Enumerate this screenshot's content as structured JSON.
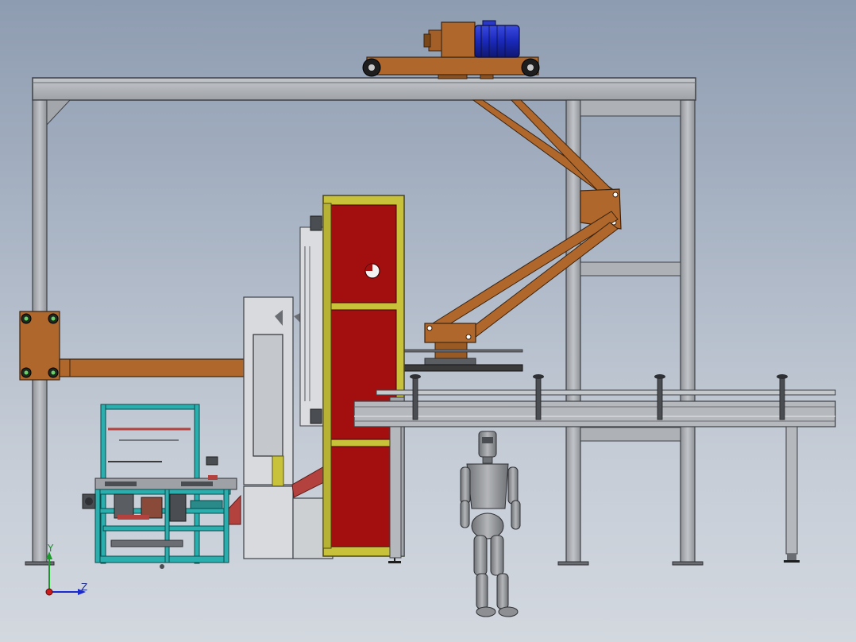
{
  "triad": {
    "y_label": "Y",
    "z_label": "Z"
  },
  "colors": {
    "frame": "#a3a6ab",
    "frame_dark": "#4a4d52",
    "brown": "#b0672c",
    "tower_red": "#a30e0e",
    "tower_trim": "#c8c23a",
    "teal": "#2aaeae",
    "motor_blue": "#2233cc",
    "conveyor": "#b5b8bc",
    "pallet_dark": "#3a3a3a",
    "robot": "#8d8f92"
  }
}
